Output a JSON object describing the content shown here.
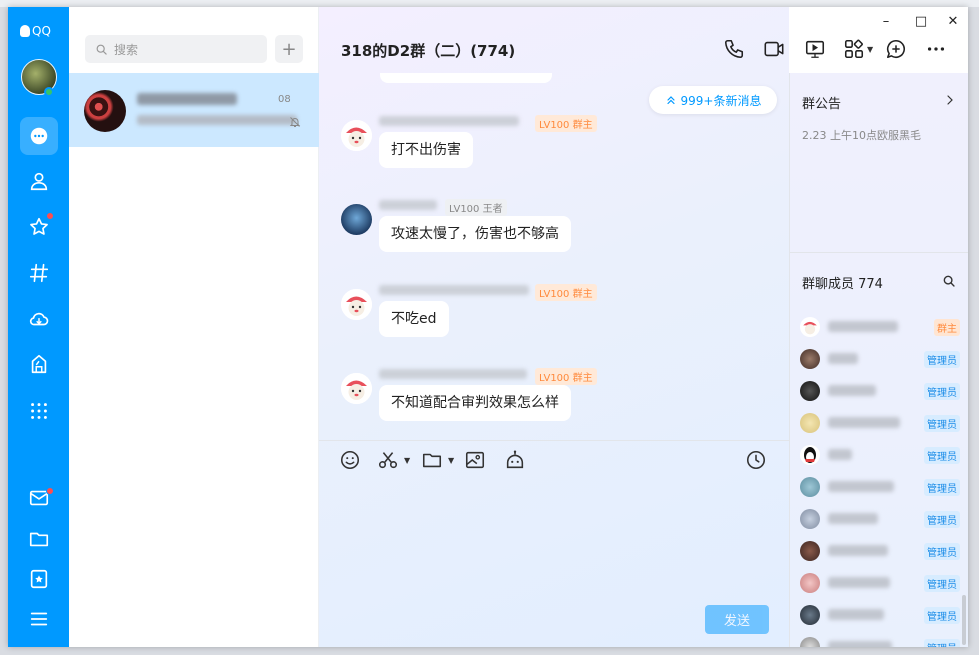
{
  "app": {
    "name": "QQ"
  },
  "colors": {
    "brand": "#0099ff",
    "owner_tag": "#ff8a3d",
    "admin_tag": "#1a8ce8",
    "unread_dot": "#ff4d4f"
  },
  "window_controls": {
    "minimize": "–",
    "maximize": "□",
    "close": "✕"
  },
  "rail": {
    "items": [
      {
        "icon": "message-icon",
        "active": true
      },
      {
        "icon": "contacts-icon"
      },
      {
        "icon": "star-icon",
        "badge": true
      },
      {
        "icon": "channel-icon"
      },
      {
        "icon": "cloud-icon"
      },
      {
        "icon": "gamebox-icon"
      },
      {
        "icon": "apps-grid-icon"
      }
    ],
    "bottom_items": [
      {
        "icon": "mail-icon",
        "badge": true
      },
      {
        "icon": "folder-icon"
      },
      {
        "icon": "favorites-icon"
      },
      {
        "icon": "menu-icon"
      }
    ]
  },
  "conversations": {
    "search_placeholder": "搜索",
    "add_label": "+",
    "items": [
      {
        "time": "08",
        "muted": true,
        "selected": true
      }
    ]
  },
  "chat": {
    "title": "318的D2群（二）(774)",
    "new_messages_label": "999+条新消息",
    "messages": [
      {
        "level": "LV100",
        "role": "群主",
        "role_type": "owner",
        "text": "打不出伤害"
      },
      {
        "level": "LV100",
        "role": "王者",
        "role_type": "king",
        "text": "攻速太慢了，伤害也不够高"
      },
      {
        "level": "LV100",
        "role": "群主",
        "role_type": "owner",
        "text": "不吃ed"
      },
      {
        "level": "LV100",
        "role": "群主",
        "role_type": "owner",
        "text": "不知道配合审判效果怎么样"
      }
    ],
    "send_label": "发送"
  },
  "side_panel": {
    "announcement_title": "群公告",
    "announcement_text": "2.23 上午10点欧服黑毛",
    "members_title": "群聊成员 774",
    "members": [
      {
        "role": "群主",
        "role_type": "owner"
      },
      {
        "role": "管理员",
        "role_type": "admin"
      },
      {
        "role": "管理员",
        "role_type": "admin"
      },
      {
        "role": "管理员",
        "role_type": "admin"
      },
      {
        "role": "管理员",
        "role_type": "admin"
      },
      {
        "role": "管理员",
        "role_type": "admin"
      },
      {
        "role": "管理员",
        "role_type": "admin"
      },
      {
        "role": "管理员",
        "role_type": "admin"
      },
      {
        "role": "管理员",
        "role_type": "admin"
      },
      {
        "role": "管理员",
        "role_type": "admin"
      },
      {
        "role": "管理员",
        "role_type": "admin"
      }
    ]
  }
}
